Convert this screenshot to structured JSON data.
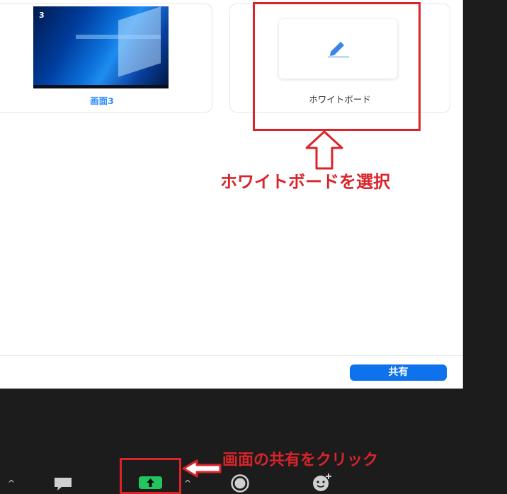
{
  "dialog": {
    "screen_card": {
      "number": "3",
      "label": "画面3"
    },
    "whiteboard_card": {
      "label": "ホワイトボード"
    },
    "share_button_label": "共有"
  },
  "annotations": {
    "select_whiteboard": "ホワイトボードを選択",
    "click_share_screen": "画面の共有をクリック"
  },
  "colors": {
    "annotation_red": "#d9242a",
    "share_blue": "#0e72ed",
    "share_green": "#22c55e"
  },
  "toolbar": {
    "icons": [
      "chat-icon",
      "share-screen-icon",
      "record-icon",
      "reactions-icon"
    ]
  }
}
